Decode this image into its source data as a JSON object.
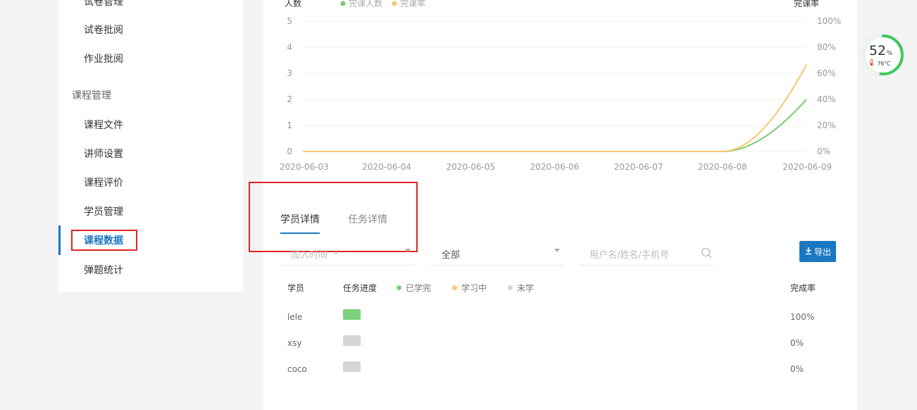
{
  "sidebar": {
    "items_top": [
      {
        "label": "试卷管理"
      },
      {
        "label": "试卷批阅"
      },
      {
        "label": "作业批阅"
      }
    ],
    "group_label": "课程管理",
    "items_course": [
      {
        "label": "课程文件"
      },
      {
        "label": "讲师设置"
      },
      {
        "label": "课程评价"
      },
      {
        "label": "学员管理"
      },
      {
        "label": "课程数据",
        "active": true
      },
      {
        "label": "弹题统计"
      }
    ]
  },
  "chart_data": {
    "type": "line",
    "ylabel_left": "人数",
    "ylabel_right": "完课率",
    "legend": [
      "完课人数",
      "完课率"
    ],
    "x": [
      "2020-06-03",
      "2020-06-04",
      "2020-06-05",
      "2020-06-06",
      "2020-06-07",
      "2020-06-08",
      "2020-06-09"
    ],
    "y_left_ticks": [
      "5",
      "4",
      "3",
      "2",
      "1",
      "0"
    ],
    "y_right_ticks": [
      "100%",
      "80%",
      "60%",
      "40%",
      "20%",
      "0%"
    ],
    "ylim_left": [
      0,
      5
    ],
    "ylim_right": [
      0,
      100
    ],
    "series": [
      {
        "name": "完课人数",
        "axis": "left",
        "values": [
          0,
          0,
          0,
          0,
          0,
          0,
          2
        ],
        "color": "#7cc96f"
      },
      {
        "name": "完课率",
        "axis": "right",
        "values": [
          0,
          0,
          0,
          0,
          0,
          0,
          66.7
        ],
        "color": "#f5c96b"
      }
    ]
  },
  "tabs": [
    {
      "label": "学员详情",
      "active": true
    },
    {
      "label": "任务详情",
      "active": false
    }
  ],
  "filters": {
    "time_placeholder": "加入时间",
    "status_value": "全部",
    "search_placeholder": "用户名/姓名/手机号"
  },
  "export_label": "导出",
  "table": {
    "headers": {
      "student": "学员",
      "progress": "任务进度",
      "rate": "完成率"
    },
    "legend": [
      {
        "label": "已学完",
        "color": "#7cd07a"
      },
      {
        "label": "学习中",
        "color": "#f7ce6c"
      },
      {
        "label": "未学",
        "color": "#d5d5d5"
      }
    ],
    "rows": [
      {
        "student": "lele",
        "status": "done",
        "rate": "100%"
      },
      {
        "student": "xsy",
        "status": "none",
        "rate": "0%"
      },
      {
        "student": "coco",
        "status": "none",
        "rate": "0%"
      }
    ]
  },
  "gauge": {
    "percent": "52",
    "unit": "%",
    "temp": "76°C",
    "ring_color": "#3cc75a"
  }
}
